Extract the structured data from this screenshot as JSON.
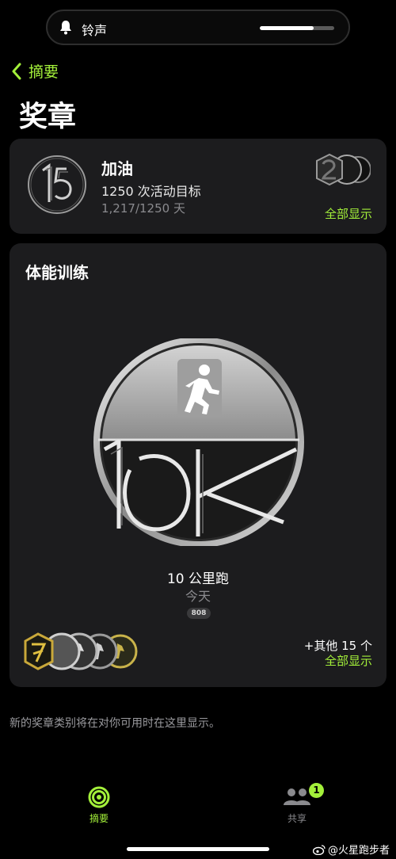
{
  "notification": {
    "icon": "bell-icon",
    "label": "铃声",
    "volume": 0.72
  },
  "nav": {
    "back_label": "摘要",
    "title": "奖章"
  },
  "featured": {
    "name": "加油",
    "description": "1250 次活动目标",
    "progress_text": "1,217/1250 天",
    "show_all": "全部显示"
  },
  "workouts": {
    "section_title": "体能训练",
    "award_name": "10 公里跑",
    "award_date": "今天",
    "award_count": "808",
    "more_text": "+其他 15 个",
    "show_all": "全部显示"
  },
  "footer_note": "新的奖章类别将在对你可用时在这里显示。",
  "tabs": [
    {
      "label": "摘要",
      "icon": "activity-rings-icon",
      "active": true
    },
    {
      "label": "共享",
      "icon": "people-icon",
      "badge": "1"
    }
  ],
  "watermark": "@火星跑步者",
  "colors": {
    "accent": "#a3f03a",
    "card": "#1c1c1e",
    "background": "#000000"
  }
}
